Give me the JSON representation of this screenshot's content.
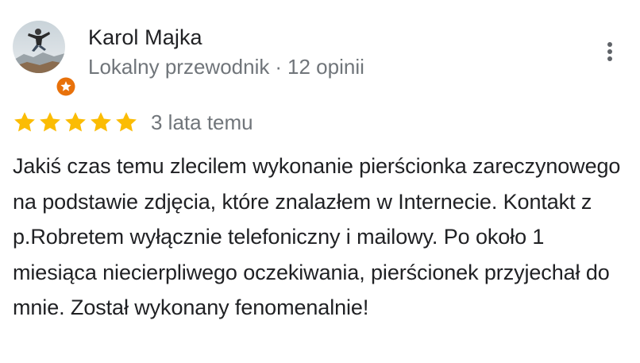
{
  "review": {
    "author": {
      "name": "Karol Majka",
      "role": "Lokalny przewodnik",
      "separator": "·",
      "review_count": "12 opinii",
      "avatar": "person-jumping-photo",
      "badge_icon": "local-guide-star-badge"
    },
    "menu_icon": "more-vert-icon",
    "rating": 5,
    "max_rating": 5,
    "star_color": "#fbbc04",
    "time": "3 lata temu",
    "text": "Jakiś czas temu zlecilem wykonanie pierścionka zareczynowego na podstawie zdjęcia, które znalazłem w Internecie. Kontakt z p.Robretem wyłącznie telefoniczny i mailowy. Po około 1 miesiąca niecierpliwego oczekiwania, pierścionek przyjechał do mnie. Został wykonany fenomenalnie!"
  },
  "colors": {
    "text_primary": "#202124",
    "text_secondary": "#70757a",
    "badge_orange": "#e8710a"
  }
}
